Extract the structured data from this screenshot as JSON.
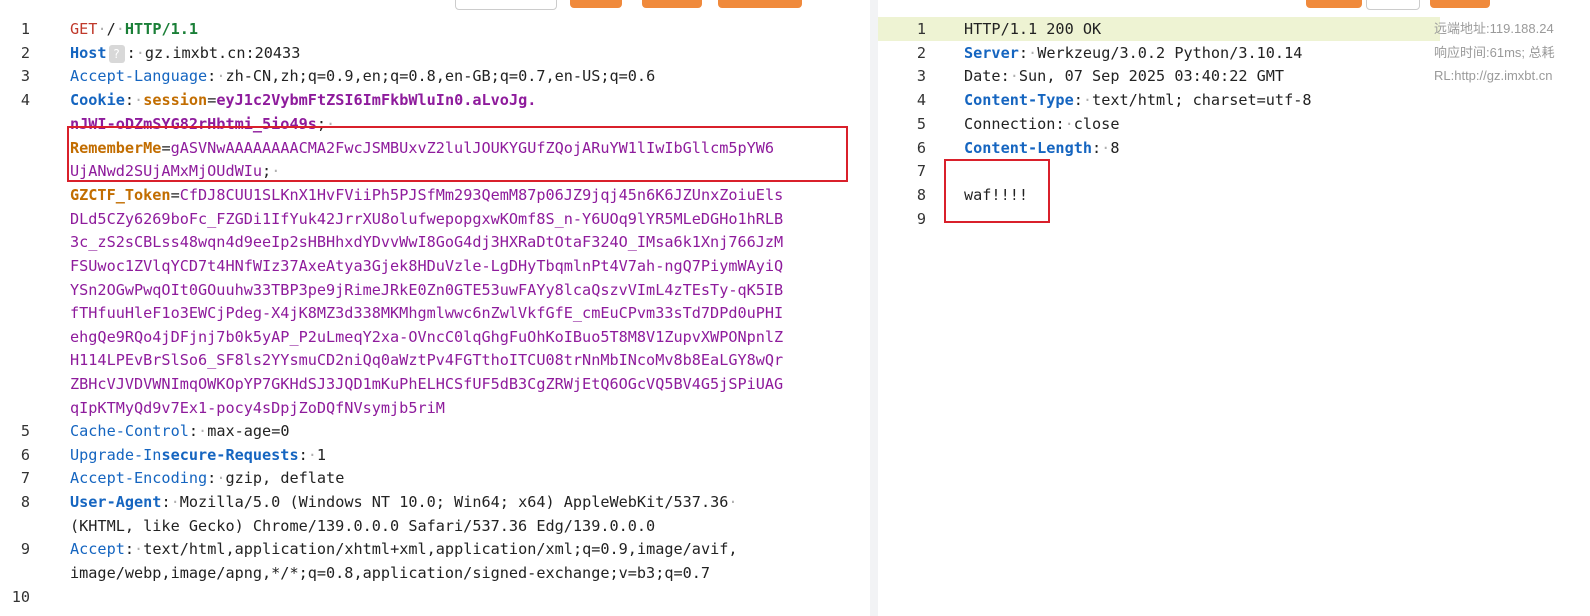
{
  "request": {
    "line_numbers": [
      "1",
      "2",
      "3",
      "4",
      "5",
      "6",
      "7",
      "8",
      "9",
      "10"
    ],
    "method": "GET",
    "path": "/",
    "version": "HTTP/1.1",
    "host_key": "Host",
    "host_help": "?",
    "host_value": "gz.imxbt.cn:20433",
    "accept_language_key": "Accept-Language",
    "accept_language_value": "zh-CN,zh;q=0.9,en;q=0.8,en-GB;q=0.7,en-US;q=0.6",
    "cookie_key": "Cookie",
    "session_key": "session",
    "session_value_1": "eyJ1c2VybmFtZSI6ImFkbWluIn0.aLvoJg.",
    "session_value_2": "nJWI-oDZmSYG82rHbtmi_5io49s",
    "rememberme_key": "RememberMe",
    "rememberme_value_1": "gASVNwAAAAAAAACMA2FwcJSMBUxvZ2lulJOUKYGUfZQojARuYW1lIwIbGllcm5pYW6",
    "rememberme_value_2": "UjANwd2SUjAMxMjOUdWIu",
    "gzctf_key": "GZCTF_Token",
    "gzctf_lines": [
      "CfDJ8CUU1SLKnX1HvFViiPh5PJSfMm293QemM87p06JZ9jqj45n6K6JZUnxZoiuEls",
      "DLd5CZy6269boFc_FZGDi1IfYuk42JrrXU8olufwepopgxwKOmf8S_n-Y6UOq9lYR5MLeDGHo1hRLB",
      "3c_zS2sCBLss48wqn4d9eeIp2sHBHhxdYDvvWwI8GoG4dj3HXRaDtOtaF324O_IMsa6k1Xnj766JzM",
      "FSUwoc1ZVlqYCD7t4HNfWIz37AxeAtya3Gjek8HDuVzle-LgDHyTbqmlnPt4V7ah-ngQ7PiymWAyiQ",
      "YSn2OGwPwqOIt0GOuuhw33TBP3pe9jRimeJRkE0Zn0GTE53uwFAYy8lcaQszvVImL4zTEsTy-qK5IB",
      "fTHfuuHleF1o3EWCjPdeg-X4jK8MZ3d338MKMhgmlwwc6nZwlVkfGfE_cmEuCPvm33sTd7DPd0uPHI",
      "ehgQe9RQo4jDFjnj7b0k5yAP_P2uLmeqY2xa-OVncC0lqGhgFuOhKoIBuo5T8M8V1ZupvXWPONpnlZ",
      "H114LPEvBrSlSo6_SF8ls2YYsmuCD2niQq0aWztPv4FGTthoITCU08trNnMbINcoMv8b8EaLGY8wQr",
      "ZBHcVJVDVWNImqOWKOpYP7GKHdSJ3JQD1mKuPhELHCSfUF5dB3CgZRWjEtQ6OGcVQ5BV4G5jSPiUAG",
      "qIpKTMyQd9v7Ex1-pocy4sDpjZoDQfNVsymjb5riM"
    ],
    "cache_control_key": "Cache-Control",
    "cache_control_value": "max-age=0",
    "upgrade_key_a": "Upgrade-In",
    "upgrade_key_b": "secure-Requests",
    "upgrade_value": "1",
    "accept_encoding_key": "Accept-Encoding",
    "accept_encoding_value": "gzip, deflate",
    "user_agent_key": "User-Agent",
    "user_agent_value_1": "Mozilla/5.0 (Windows NT 10.0; Win64; x64) AppleWebKit/537.36",
    "user_agent_value_2": "(KHTML, like Gecko) Chrome/139.0.0.0 Safari/537.36 Edg/139.0.0.0",
    "accept_key": "Accept",
    "accept_value_1": "text/html,application/xhtml+xml,application/xml;q=0.9,image/avif,",
    "accept_value_2": "image/webp,image/apng,*/*;q=0.8,application/signed-exchange;v=b3;q=0.7"
  },
  "response": {
    "line_numbers": [
      "1",
      "2",
      "3",
      "4",
      "5",
      "6",
      "7",
      "8",
      "9"
    ],
    "status_line": "HTTP/1.1 200 OK",
    "server_key": "Server",
    "server_value": "Werkzeug/3.0.2 Python/3.10.14",
    "date_key": "Date",
    "date_value": "Sun, 07 Sep 2025 03:40:22 GMT",
    "content_type_key": "Content-Type",
    "content_type_value": "text/html; charset=utf-8",
    "connection_key": "Connection",
    "connection_value": "close",
    "content_length_key": "Content-Length",
    "content_length_value": "8",
    "body": "waf!!!!"
  },
  "meta": {
    "remote_address": "远端地址:119.188.24",
    "response_time": "响应时间:61ms; 总耗",
    "url": "RL:http://gz.imxbt.cn"
  },
  "colors": {
    "highlight_box": "#d9202b",
    "status_highlight": "#eef3d3",
    "accent_orange": "#f08a3c"
  }
}
